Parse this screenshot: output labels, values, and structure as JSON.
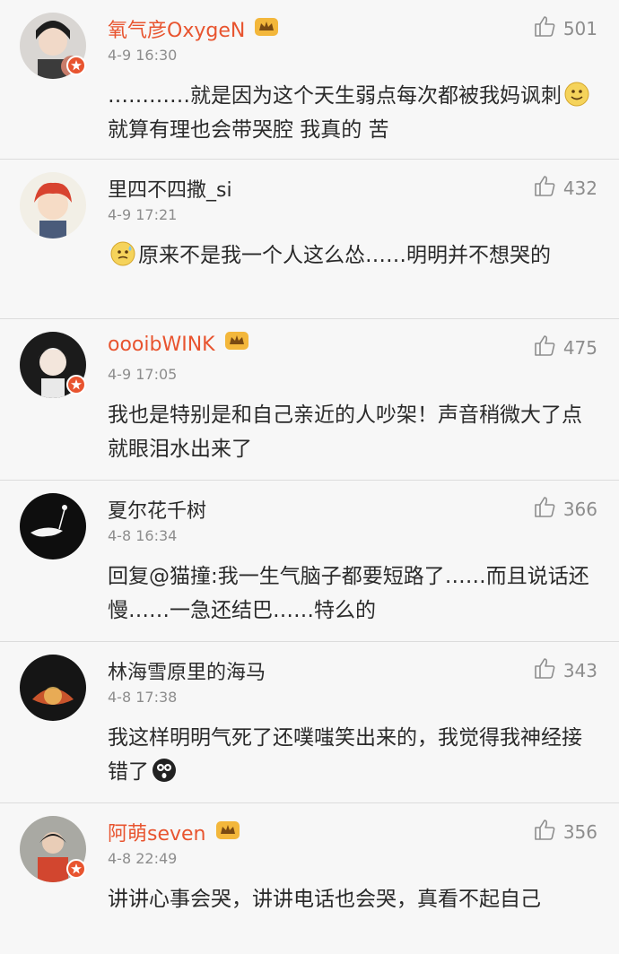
{
  "comments": [
    {
      "username": "氧气彦OxygeN",
      "vip": true,
      "time": "4-9 16:30",
      "likes": "501",
      "text_before": "…………就是因为这个天生弱点每次都被我妈讽刺",
      "emoji": "smile",
      "text_after": "就算有理也会带哭腔 我真的 苦"
    },
    {
      "username": "里四不四撒_si",
      "vip": false,
      "time": "4-9 17:21",
      "likes": "432",
      "text_before": "",
      "emoji": "sweat",
      "text_after": "原来不是我一个人这么怂……明明并不想哭的"
    },
    {
      "username": "oooibWINK",
      "vip": true,
      "time": "4-9 17:05",
      "likes": "475",
      "text_before": "我也是特别是和自己亲近的人吵架！声音稍微大了点就眼泪水出来了",
      "emoji": "",
      "text_after": ""
    },
    {
      "username": "夏尔花千树",
      "vip": false,
      "time": "4-8 16:34",
      "likes": "366",
      "text_before": "回复@猫撞:我一生气脑子都要短路了……而且说话还慢……一急还结巴……特么的",
      "emoji": "",
      "text_after": ""
    },
    {
      "username": "林海雪原里的海马",
      "vip": false,
      "time": "4-8 17:38",
      "likes": "343",
      "text_before": "我这样明明气死了还噗嗤笑出来的，我觉得我神经接错了",
      "emoji": "shocked",
      "text_after": ""
    },
    {
      "username": "阿萌seven",
      "vip": true,
      "time": "4-8 22:49",
      "likes": "356",
      "text_before": "讲讲心事会哭，讲讲电话也会哭，真看不起自己",
      "emoji": "",
      "text_after": ""
    }
  ],
  "icons": {
    "like": "thumbs-up-outline-icon",
    "vip": "crown-icon",
    "badge": "star-badge-icon"
  },
  "colors": {
    "vip_name": "#e8542f",
    "meta": "#8d8d8d",
    "text": "#2a2a2a",
    "background": "#f7f7f7"
  }
}
